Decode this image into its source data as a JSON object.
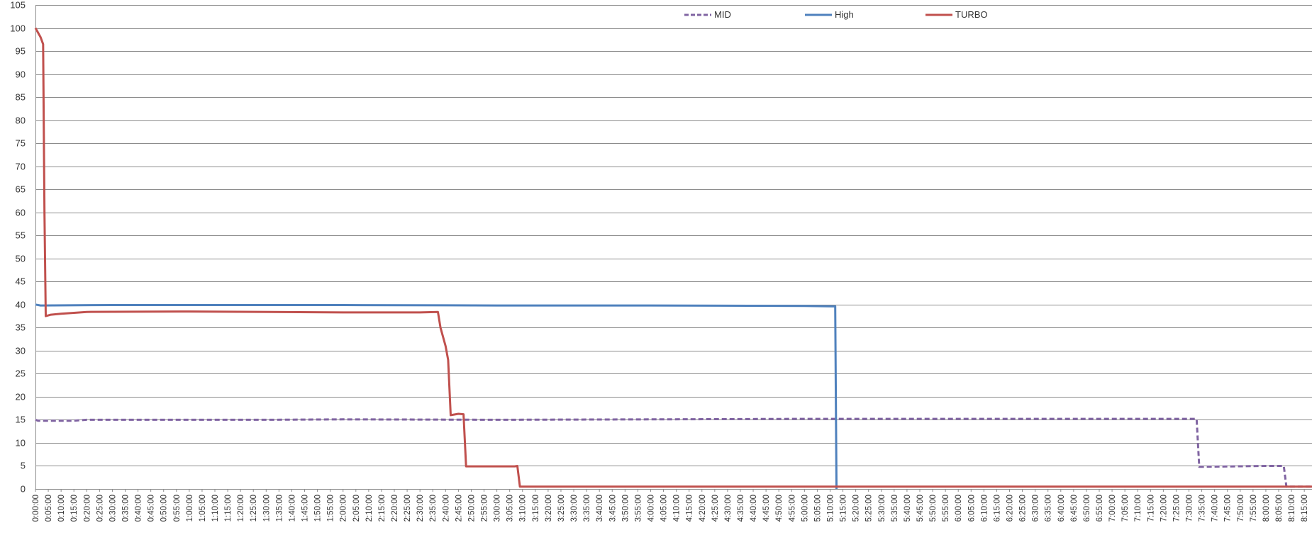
{
  "chart_data": {
    "type": "line",
    "title": "",
    "xlabel": "",
    "ylabel": "",
    "ylim": [
      0,
      105
    ],
    "y_ticks": [
      0,
      5,
      10,
      15,
      20,
      25,
      30,
      35,
      40,
      45,
      50,
      55,
      60,
      65,
      70,
      75,
      80,
      85,
      90,
      95,
      100,
      105
    ],
    "x_tick_step": "0:05:00",
    "x_tick_labels": [
      "0:00:00",
      "0:05:00",
      "0:10:00",
      "0:15:00",
      "0:20:00",
      "0:25:00",
      "0:30:00",
      "0:35:00",
      "0:40:00",
      "0:45:00",
      "0:50:00",
      "0:55:00",
      "1:00:00",
      "1:05:00",
      "1:10:00",
      "1:15:00",
      "1:20:00",
      "1:25:00",
      "1:30:00",
      "1:35:00",
      "1:40:00",
      "1:45:00",
      "1:50:00",
      "1:55:00",
      "2:00:00",
      "2:05:00",
      "2:10:00",
      "2:15:00",
      "2:20:00",
      "2:25:00",
      "2:30:00",
      "2:35:00",
      "2:40:00",
      "2:45:00",
      "2:50:00",
      "2:55:00",
      "3:00:00",
      "3:05:00",
      "3:10:00",
      "3:15:00",
      "3:20:00",
      "3:25:00",
      "3:30:00",
      "3:35:00",
      "3:40:00",
      "3:45:00",
      "3:50:00",
      "3:55:00",
      "4:00:00",
      "4:05:00",
      "4:10:00",
      "4:15:00",
      "4:20:00",
      "4:25:00",
      "4:30:00",
      "4:35:00",
      "4:40:00",
      "4:45:00",
      "4:50:00",
      "4:55:00",
      "5:00:00",
      "5:05:00",
      "5:10:00",
      "5:15:00",
      "5:20:00",
      "5:25:00",
      "5:30:00",
      "5:35:00",
      "5:40:00",
      "5:45:00",
      "5:50:00",
      "5:55:00",
      "6:00:00",
      "6:05:00",
      "6:10:00",
      "6:15:00",
      "6:20:00",
      "6:25:00",
      "6:30:00",
      "6:35:00",
      "6:40:00",
      "6:45:00",
      "6:50:00",
      "6:55:00",
      "7:00:00",
      "7:05:00",
      "7:10:00",
      "7:15:00",
      "7:20:00",
      "7:25:00",
      "7:30:00",
      "7:35:00",
      "7:40:00",
      "7:45:00",
      "7:50:00",
      "7:55:00",
      "8:00:00",
      "8:05:00",
      "8:10:00",
      "8:15:00"
    ],
    "grid": true,
    "legend_position": "top-center",
    "series": [
      {
        "name": "MID",
        "color": "#8064a2",
        "dash": "dashed",
        "points": [
          [
            "0:00:00",
            15.0
          ],
          [
            "0:01:00",
            14.8
          ],
          [
            "0:15:00",
            14.8
          ],
          [
            "0:20:00",
            15.0
          ],
          [
            "1:30:00",
            15.0
          ],
          [
            "2:00:00",
            15.1
          ],
          [
            "3:00:00",
            15.0
          ],
          [
            "4:00:00",
            15.1
          ],
          [
            "5:00:00",
            15.2
          ],
          [
            "6:00:00",
            15.2
          ],
          [
            "7:00:00",
            15.2
          ],
          [
            "7:33:00",
            15.2
          ],
          [
            "7:34:00",
            4.8
          ],
          [
            "8:00:00",
            5.0
          ],
          [
            "8:07:00",
            5.0
          ],
          [
            "8:08:00",
            0.5
          ],
          [
            "8:18:00",
            0.5
          ]
        ]
      },
      {
        "name": "High",
        "color": "#4f81bd",
        "dash": "solid",
        "points": [
          [
            "0:00:00",
            40.0
          ],
          [
            "0:02:00",
            39.8
          ],
          [
            "0:30:00",
            39.9
          ],
          [
            "1:00:00",
            39.9
          ],
          [
            "2:00:00",
            39.9
          ],
          [
            "3:00:00",
            39.8
          ],
          [
            "4:00:00",
            39.8
          ],
          [
            "5:00:00",
            39.7
          ],
          [
            "5:12:00",
            39.6
          ],
          [
            "5:12:30",
            0.0
          ]
        ]
      },
      {
        "name": "TURBO",
        "color": "#c0504d",
        "dash": "solid",
        "points": [
          [
            "0:00:00",
            100.0
          ],
          [
            "0:01:00",
            99.0
          ],
          [
            "0:02:00",
            98.0
          ],
          [
            "0:03:00",
            96.5
          ],
          [
            "0:03:30",
            60.0
          ],
          [
            "0:04:00",
            37.5
          ],
          [
            "0:06:00",
            37.8
          ],
          [
            "0:10:00",
            38.0
          ],
          [
            "0:20:00",
            38.4
          ],
          [
            "1:00:00",
            38.5
          ],
          [
            "2:00:00",
            38.3
          ],
          [
            "2:30:00",
            38.3
          ],
          [
            "2:37:00",
            38.4
          ],
          [
            "2:38:00",
            35.0
          ],
          [
            "2:40:00",
            31.0
          ],
          [
            "2:41:00",
            28.0
          ],
          [
            "2:42:00",
            16.0
          ],
          [
            "2:45:00",
            16.3
          ],
          [
            "2:47:00",
            16.2
          ],
          [
            "2:48:00",
            4.9
          ],
          [
            "3:07:00",
            4.9
          ],
          [
            "3:08:00",
            5.0
          ],
          [
            "3:09:00",
            0.5
          ],
          [
            "8:18:00",
            0.5
          ]
        ]
      }
    ]
  }
}
